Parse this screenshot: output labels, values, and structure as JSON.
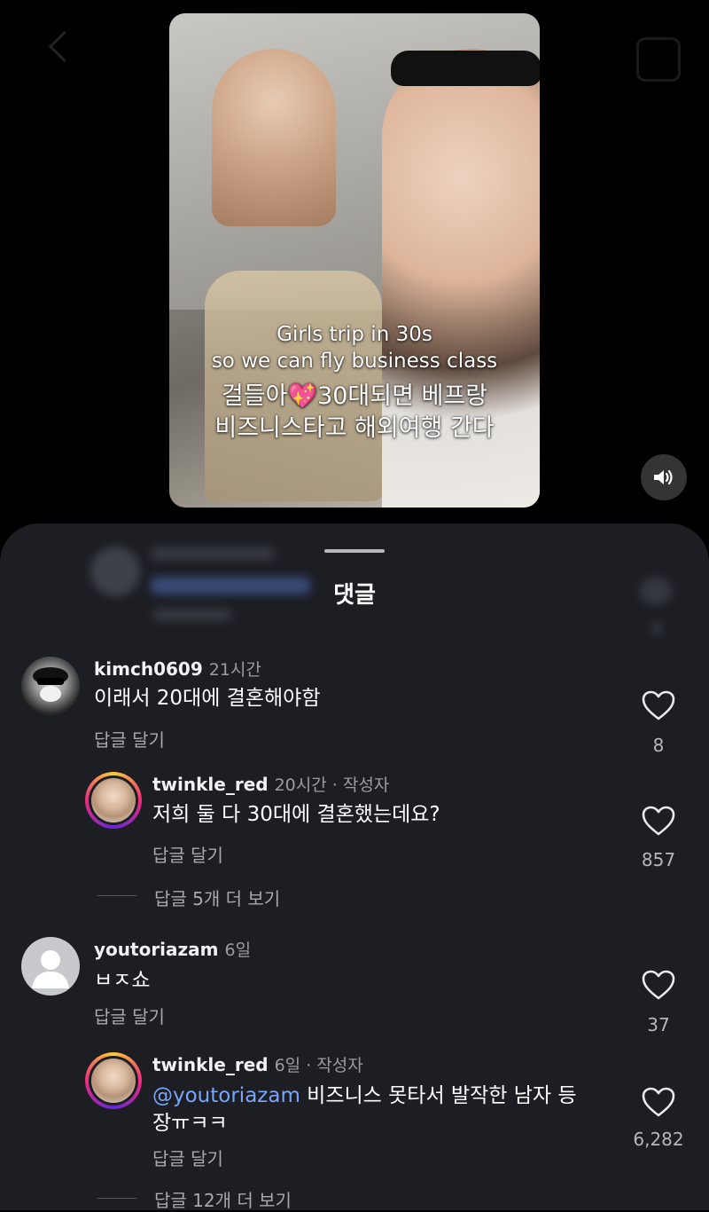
{
  "video": {
    "caption_line1": "Girls trip in 30s",
    "caption_line2": "so we can fly business class",
    "caption_line3_before": "걸들아",
    "caption_line3_emoji": "💖",
    "caption_line3_after": "30대되면 베프랑",
    "caption_line4": "비즈니스타고 해외여행 간다",
    "mute_icon": "speaker-icon"
  },
  "sheet": {
    "title": "댓글"
  },
  "comments": [
    {
      "username": "kimch0609",
      "time": "21시간",
      "text": "이래서 20대에 결혼해야함",
      "reply_label": "답글 달기",
      "likes": "8"
    },
    {
      "username": "twinkle_red",
      "time": "20시간",
      "author_tag": " · 작성자",
      "text": "저희 둘 다 30대에 결혼했는데요?",
      "reply_label": "답글 달기",
      "likes": "857",
      "more_replies": "답글 5개 더 보기"
    },
    {
      "username": "youtoriazam",
      "time": "6일",
      "text": "ㅂㅈ쇼",
      "reply_label": "답글 달기",
      "likes": "37"
    },
    {
      "username": "twinkle_red",
      "time": "6일",
      "author_tag": " · 작성자",
      "mention": "@youtoriazam",
      "text_line1": " 비즈니스 못타서 발작한 남자 등",
      "text_line2": "장ㅠㅋㅋ",
      "reply_label": "답글 달기",
      "likes": "6,282",
      "more_replies": "답글 12개 더 보기"
    }
  ],
  "colors": {
    "sheet_bg": "#1c1e24",
    "mention": "#7ca4f6",
    "muted_text": "#a7a9b0"
  }
}
